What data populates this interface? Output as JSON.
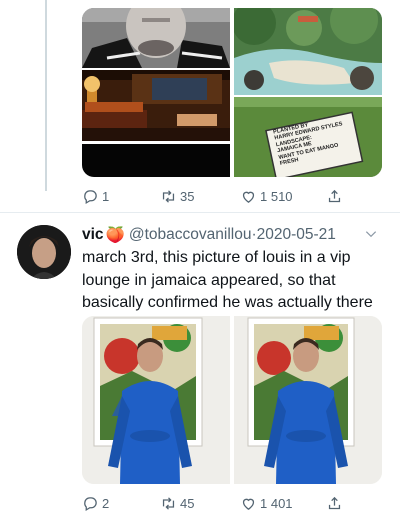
{
  "tweet_above": {
    "media": [
      {
        "icon": "photo-man-hoodie-closeup"
      },
      {
        "icon": "photo-lounge-interior-night"
      },
      {
        "icon": "photo-dark"
      },
      {
        "icon": "photo-beach-cove-aerial"
      },
      {
        "icon": "photo-planted-by-sign"
      }
    ],
    "sign_lines": [
      "PLANTED BY",
      "HARRY EDWARD STYLES",
      "LANDSCAPE:",
      "JAMAICA ME",
      "WANT TO EAT MANGO",
      "FRESH"
    ],
    "actions": {
      "replies": "1",
      "retweets": "35",
      "likes": "1 510"
    }
  },
  "tweet": {
    "display_name": "vic",
    "emoji": "🍑",
    "handle": "@tobaccovanillou",
    "separator": "·",
    "date": "2020-05-21",
    "text": "march 3rd, this picture of louis in a vip lounge in jamaica appeared, so that basically confirmed he was actually there",
    "media": [
      {
        "icon": "photo-man-blue-hoodie-wall-art"
      },
      {
        "icon": "photo-man-blue-hoodie-wall-art"
      }
    ],
    "actions": {
      "replies": "2",
      "retweets": "45",
      "likes": "1 401"
    }
  },
  "colors": {
    "secondary_text": "#536471",
    "divider": "#e6ecf0",
    "thread_line": "#cfd9de"
  }
}
